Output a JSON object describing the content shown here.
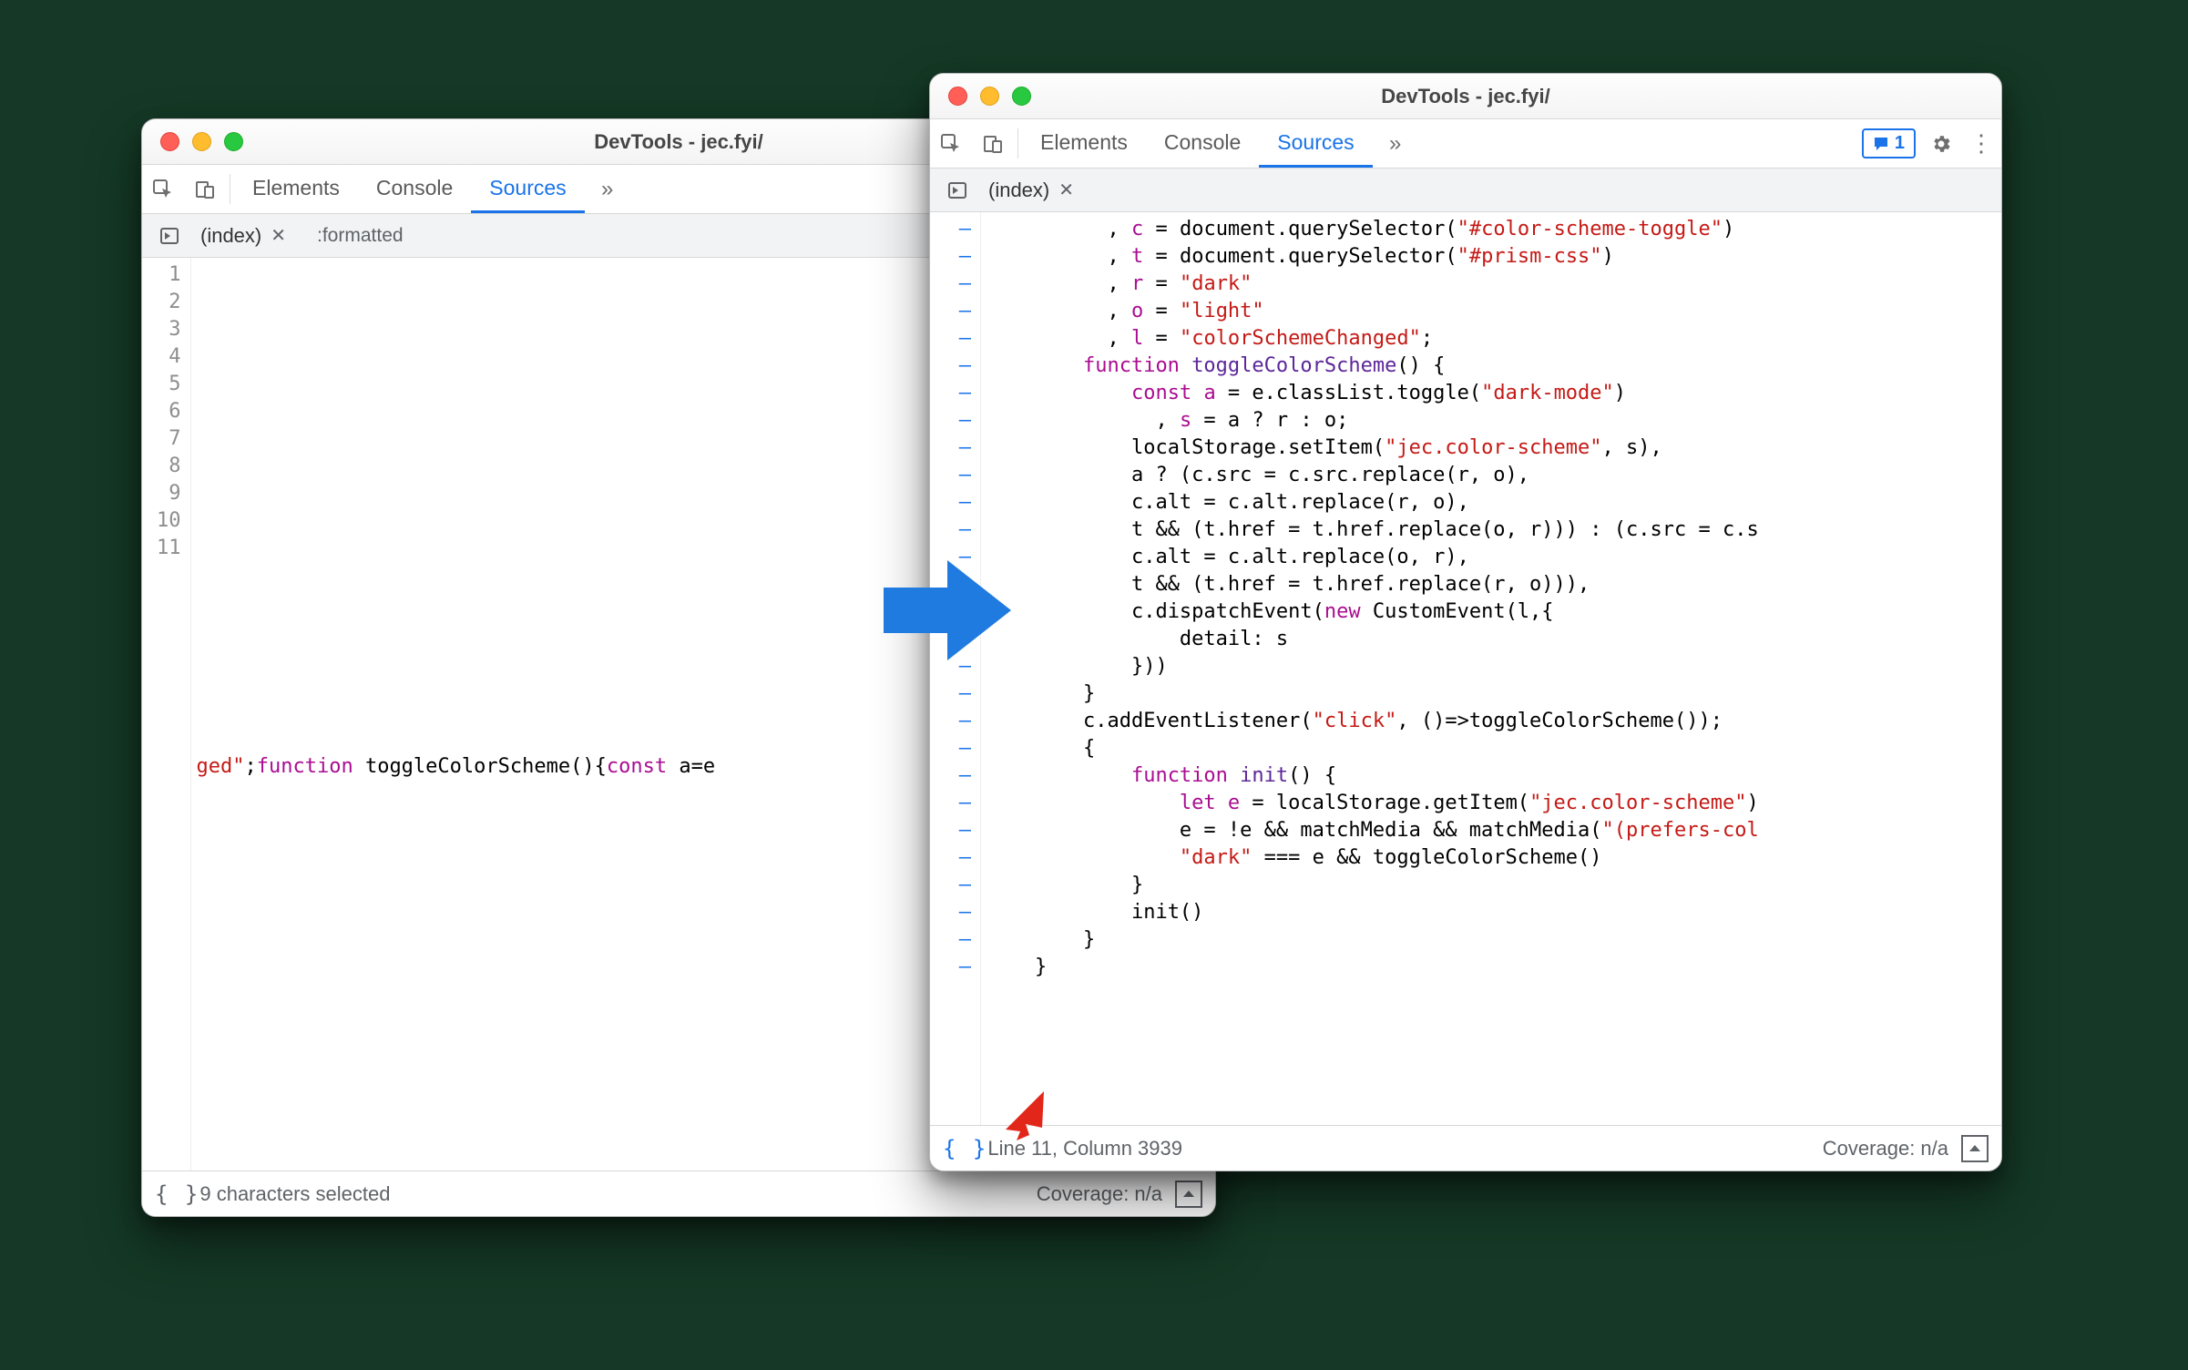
{
  "windowA": {
    "title": "DevTools - jec.fyi/",
    "tabs": {
      "elements": "Elements",
      "console": "Console",
      "sources": "Sources",
      "more": "»"
    },
    "filebar": {
      "index": "(index)",
      "formatted": ":formatted"
    },
    "gutter_lines": [
      "1",
      "2",
      "3",
      "4",
      "5",
      "6",
      "7",
      "8",
      "9",
      "10",
      "11"
    ],
    "code": {
      "l11_a": "ged\"",
      "l11_b": ";",
      "l11_c": "function",
      "l11_d": " toggleColorScheme(){",
      "l11_e": "const",
      "l11_f": " a=e"
    },
    "footer": {
      "braces": "{ }",
      "status": "  9 characters selected",
      "coverage": "Coverage: n/a"
    }
  },
  "windowB": {
    "title": "DevTools - jec.fyi/",
    "tabs": {
      "elements": "Elements",
      "console": "Console",
      "sources": "Sources",
      "more": "»"
    },
    "badge": {
      "count": "1"
    },
    "filebar": {
      "index": "(index)"
    },
    "gutter_dash": "–",
    "footer": {
      "braces": "{ }",
      "status": "  Line 11, Column 3939",
      "coverage": "Coverage: n/a"
    },
    "code_lines": [
      {
        "indent": 10,
        "seq": [
          [
            "op",
            ", "
          ],
          [
            "kw",
            "c"
          ],
          [
            "op",
            " = "
          ],
          [
            "id",
            "document"
          ],
          [
            "op",
            "."
          ],
          [
            "id",
            "querySelector"
          ],
          [
            "op",
            "("
          ],
          [
            "str",
            "\"#color-scheme-toggle\""
          ],
          [
            "op",
            ")"
          ]
        ]
      },
      {
        "indent": 10,
        "seq": [
          [
            "op",
            ", "
          ],
          [
            "kw",
            "t"
          ],
          [
            "op",
            " = "
          ],
          [
            "id",
            "document"
          ],
          [
            "op",
            "."
          ],
          [
            "id",
            "querySelector"
          ],
          [
            "op",
            "("
          ],
          [
            "str",
            "\"#prism-css\""
          ],
          [
            "op",
            ")"
          ]
        ]
      },
      {
        "indent": 10,
        "seq": [
          [
            "op",
            ", "
          ],
          [
            "kw",
            "r"
          ],
          [
            "op",
            " = "
          ],
          [
            "str",
            "\"dark\""
          ]
        ]
      },
      {
        "indent": 10,
        "seq": [
          [
            "op",
            ", "
          ],
          [
            "kw",
            "o"
          ],
          [
            "op",
            " = "
          ],
          [
            "str",
            "\"light\""
          ]
        ]
      },
      {
        "indent": 10,
        "seq": [
          [
            "op",
            ", "
          ],
          [
            "kw",
            "l"
          ],
          [
            "op",
            " = "
          ],
          [
            "str",
            "\"colorSchemeChanged\""
          ],
          [
            "op",
            ";"
          ]
        ]
      },
      {
        "indent": 8,
        "seq": [
          [
            "kw",
            "function"
          ],
          [
            "op",
            " "
          ],
          [
            "typ",
            "toggleColorScheme"
          ],
          [
            "op",
            "() {"
          ]
        ]
      },
      {
        "indent": 12,
        "seq": [
          [
            "kw",
            "const"
          ],
          [
            "op",
            " "
          ],
          [
            "kw",
            "a"
          ],
          [
            "op",
            " = e.classList.toggle("
          ],
          [
            "str",
            "\"dark-mode\""
          ],
          [
            "op",
            ")"
          ]
        ]
      },
      {
        "indent": 14,
        "seq": [
          [
            "op",
            ", "
          ],
          [
            "kw",
            "s"
          ],
          [
            "op",
            " = a ? r : o;"
          ]
        ]
      },
      {
        "indent": 12,
        "seq": [
          [
            "op",
            "localStorage.setItem("
          ],
          [
            "str",
            "\"jec.color-scheme\""
          ],
          [
            "op",
            ", s),"
          ]
        ]
      },
      {
        "indent": 12,
        "seq": [
          [
            "op",
            "a ? (c.src = c.src.replace(r, o),"
          ]
        ]
      },
      {
        "indent": 12,
        "seq": [
          [
            "op",
            "c.alt = c.alt.replace(r, o),"
          ]
        ]
      },
      {
        "indent": 12,
        "seq": [
          [
            "op",
            "t && (t.href = t.href.replace(o, r))) : (c.src = c.s"
          ]
        ]
      },
      {
        "indent": 12,
        "seq": [
          [
            "op",
            "c.alt = c.alt.replace(o, r),"
          ]
        ]
      },
      {
        "indent": 12,
        "seq": [
          [
            "op",
            "t && (t.href = t.href.replace(r, o))),"
          ]
        ]
      },
      {
        "indent": 12,
        "seq": [
          [
            "op",
            "c.dispatchEvent("
          ],
          [
            "kw",
            "new"
          ],
          [
            "op",
            " CustomEvent(l,{"
          ]
        ]
      },
      {
        "indent": 16,
        "seq": [
          [
            "op",
            "detail: s"
          ]
        ]
      },
      {
        "indent": 12,
        "seq": [
          [
            "op",
            "}))"
          ]
        ]
      },
      {
        "indent": 8,
        "seq": [
          [
            "op",
            "}"
          ]
        ]
      },
      {
        "indent": 8,
        "seq": [
          [
            "op",
            "c.addEventListener("
          ],
          [
            "str",
            "\"click\""
          ],
          [
            "op",
            ", ()=>toggleColorScheme());"
          ]
        ]
      },
      {
        "indent": 8,
        "seq": [
          [
            "op",
            "{"
          ]
        ]
      },
      {
        "indent": 12,
        "seq": [
          [
            "kw",
            "function"
          ],
          [
            "op",
            " "
          ],
          [
            "typ",
            "init"
          ],
          [
            "op",
            "() {"
          ]
        ]
      },
      {
        "indent": 16,
        "seq": [
          [
            "kw",
            "let"
          ],
          [
            "op",
            " "
          ],
          [
            "kw",
            "e"
          ],
          [
            "op",
            " = localStorage.getItem("
          ],
          [
            "str",
            "\"jec.color-scheme\""
          ],
          [
            "op",
            ")"
          ]
        ]
      },
      {
        "indent": 16,
        "seq": [
          [
            "op",
            "e = !e && matchMedia && matchMedia("
          ],
          [
            "str",
            "\"(prefers-col"
          ]
        ]
      },
      {
        "indent": 16,
        "seq": [
          [
            "str",
            "\"dark\""
          ],
          [
            "op",
            " === e && toggleColorScheme()"
          ]
        ]
      },
      {
        "indent": 12,
        "seq": [
          [
            "op",
            "}"
          ]
        ]
      },
      {
        "indent": 12,
        "seq": [
          [
            "op",
            "init()"
          ]
        ]
      },
      {
        "indent": 8,
        "seq": [
          [
            "op",
            "}"
          ]
        ]
      },
      {
        "indent": 4,
        "seq": [
          [
            "op",
            "}"
          ]
        ]
      }
    ]
  }
}
